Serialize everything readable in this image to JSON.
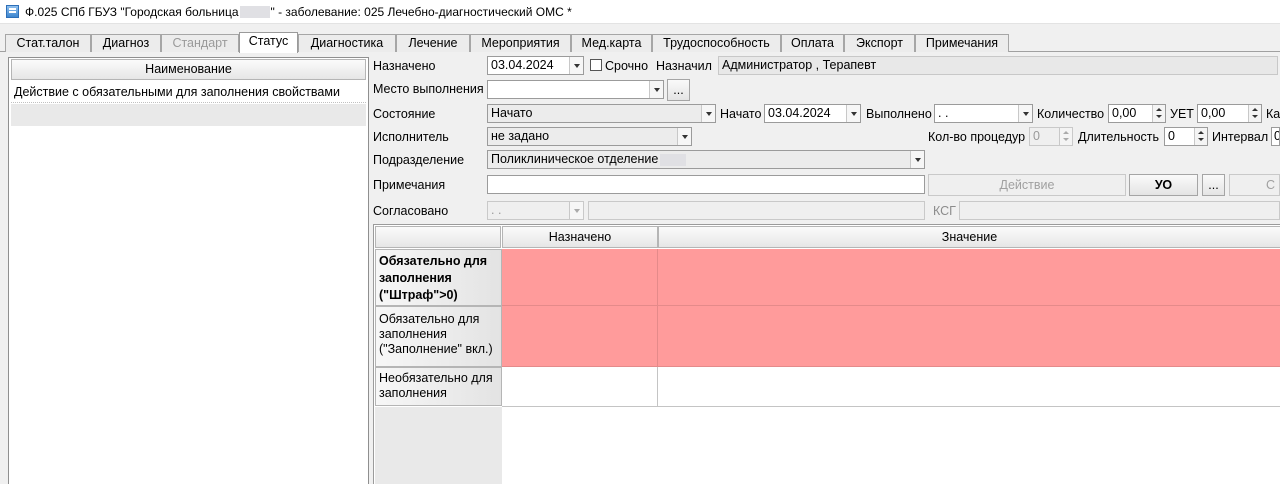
{
  "window": {
    "title_prefix": "Ф.025 СПб ГБУЗ \"Городская больница",
    "title_suffix": "\"  - заболевание: 025 Лечебно-диагностический ОМС *",
    "icon": "app-window-icon"
  },
  "tabs": [
    {
      "label": "Стат.талон"
    },
    {
      "label": "Диагноз"
    },
    {
      "label": "Стандарт"
    },
    {
      "label": "Статус"
    },
    {
      "label": "Диагностика"
    },
    {
      "label": "Лечение"
    },
    {
      "label": "Мероприятия"
    },
    {
      "label": "Мед.карта"
    },
    {
      "label": "Трудоспособность"
    },
    {
      "label": "Оплата"
    },
    {
      "label": "Экспорт"
    },
    {
      "label": "Примечания"
    }
  ],
  "active_tab": "Статус",
  "left_list": {
    "header": "Наименование",
    "items": [
      "Действие с обязательными для заполнения свойствами"
    ]
  },
  "form": {
    "assigned_label": "Назначено",
    "assigned_date": "03.04.2024",
    "urgent_label": "Срочно",
    "urgent_checked": false,
    "assigned_by_label": "Назначил",
    "assigned_by_value": "Администратор , Терапевт",
    "place_label": "Место выполнения",
    "place_value": "",
    "ellipsis": "...",
    "state_label": "Состояние",
    "state_value": "Начато",
    "started_label": "Начато",
    "started_date": "03.04.2024",
    "done_label": "Выполнено",
    "done_value": ". .",
    "quantity_label": "Количество",
    "quantity_value": "0,00",
    "uet_label": "УЕТ",
    "uet_value": "0,00",
    "cut_label": "Ка",
    "executor_label": "Исполнитель",
    "executor_value": "не задано",
    "procedures_label": "Кол-во процедур",
    "procedures_value": "0",
    "duration_label": "Длительность",
    "duration_value": "0",
    "interval_label": "Интервал",
    "interval_value": "0",
    "department_label": "Подразделение",
    "department_value": "Поликлиническое отделение",
    "notes_label": "Примечания",
    "notes_value": "",
    "action_button": "Действие",
    "uo_button": "УО",
    "extra_button": "С",
    "approved_label": "Согласовано",
    "approved_date": ". .",
    "approved_text": "",
    "ksg_label": "КСГ",
    "ksg_value": ""
  },
  "grid": {
    "columns": [
      "Назначено",
      "Значение"
    ],
    "rows": [
      {
        "label": "Обязательно для заполнения (\"Штраф\">0)",
        "required": true,
        "bold": true
      },
      {
        "label": "Обязательно для заполнения (\"Заполнение\" вкл.)",
        "required": true,
        "bold": false
      },
      {
        "label": "Необязательно для заполнения",
        "required": false,
        "bold": false
      }
    ]
  },
  "colors": {
    "required_fill": "#ff9b9b",
    "header_bg": "#e6e6e6"
  }
}
